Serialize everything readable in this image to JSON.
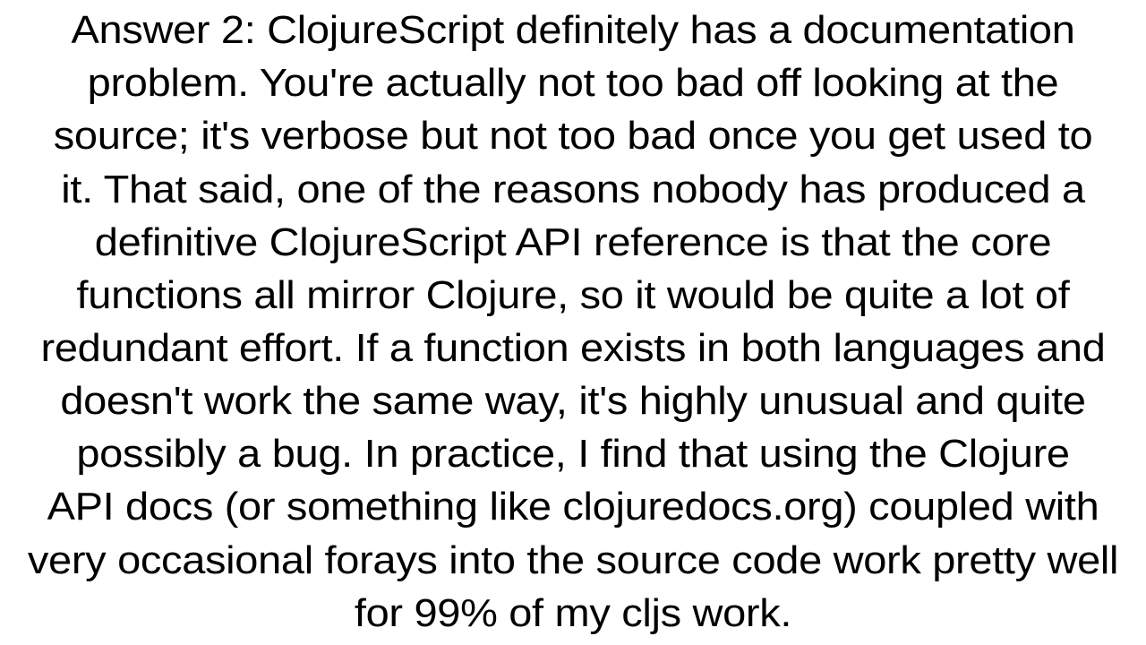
{
  "answer": {
    "label": "Answer 2:",
    "body": "Answer 2: ClojureScript definitely has a documentation\nproblem. You're actually not too bad off looking at the\nsource; it's verbose but not too bad once you get used to\nit. That said, one of the reasons nobody has produced a\ndefinitive ClojureScript API reference is that the core\nfunctions all mirror Clojure, so it would be quite a lot of\nredundant effort. If a function exists in both languages and\ndoesn't work the same way, it's highly unusual and quite\npossibly a bug. In practice, I find that using the Clojure\nAPI docs (or something like clojuredocs.org) coupled with\nvery occasional forays into the source code work pretty well\nfor 99% of my cljs work."
  }
}
